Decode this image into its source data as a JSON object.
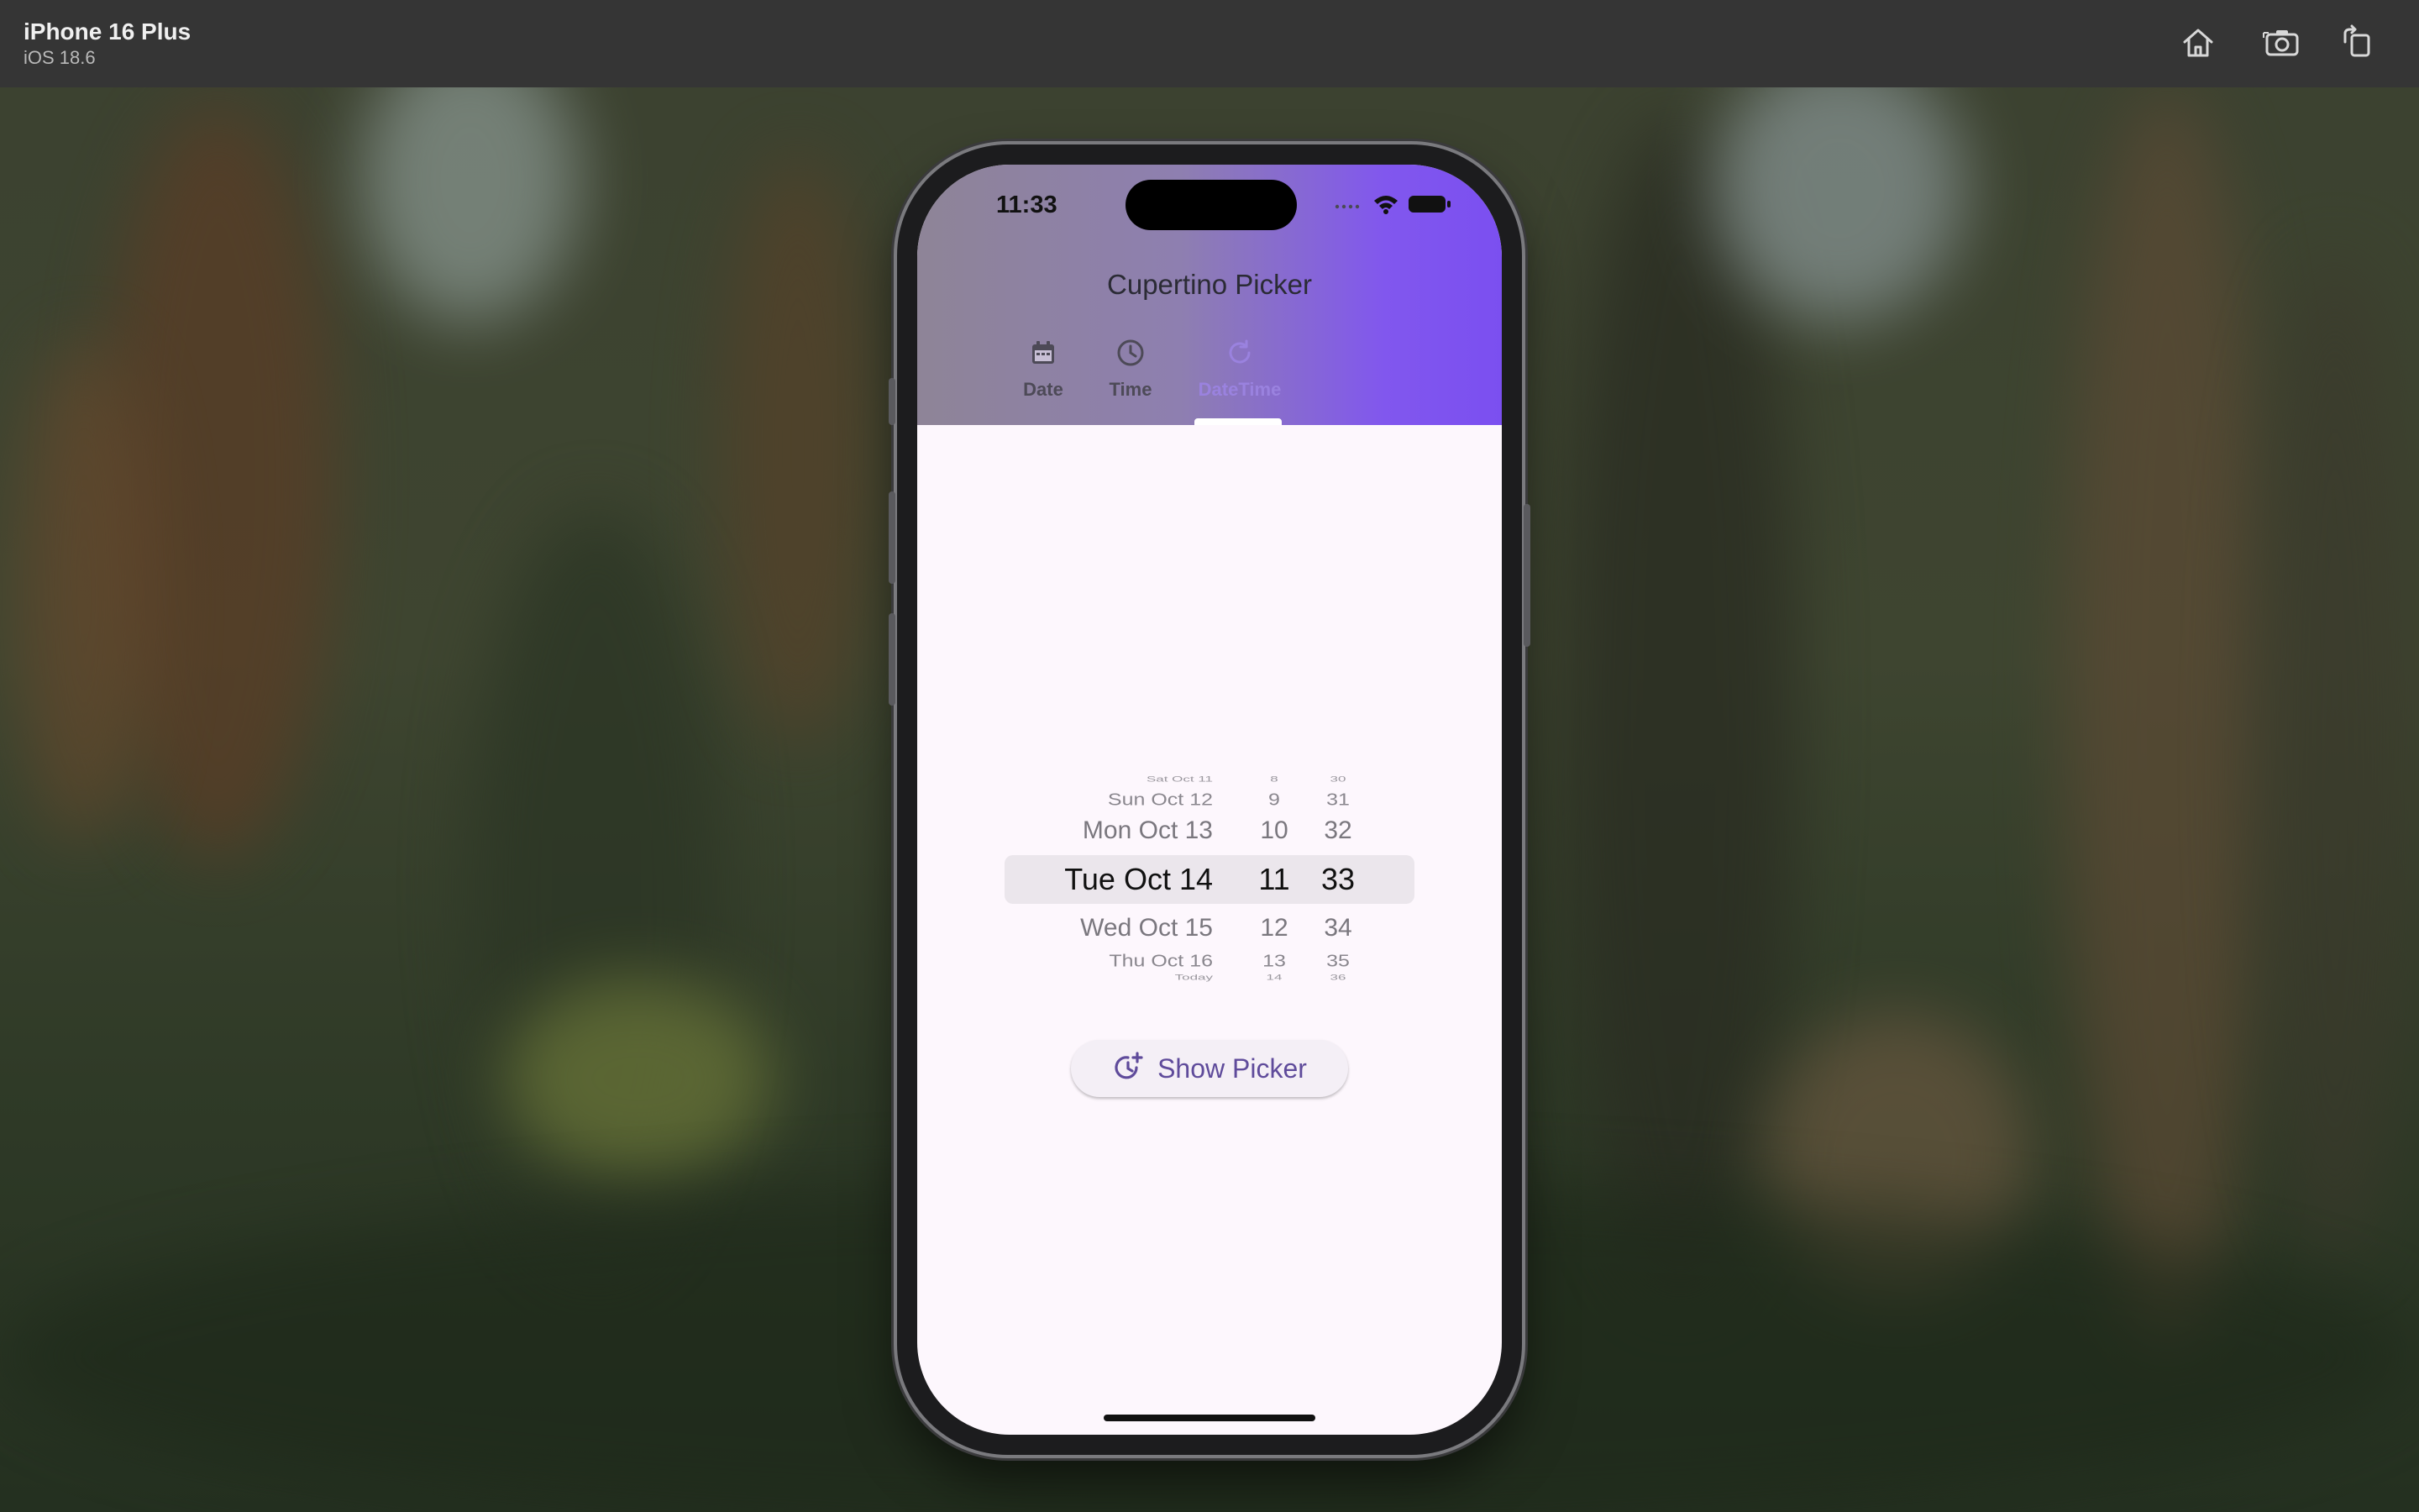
{
  "simulator": {
    "device_name": "iPhone 16 Plus",
    "os_version": "iOS 18.6",
    "toolbar": [
      "home-icon",
      "screenshot-icon",
      "rotate-icon"
    ]
  },
  "status_bar": {
    "time": "11:33"
  },
  "app": {
    "title": "Cupertino Picker",
    "accent_color": "#7b4ff0",
    "tabs": [
      {
        "label": "Date",
        "icon": "calendar-icon",
        "selected": false
      },
      {
        "label": "Time",
        "icon": "clock-icon",
        "selected": false
      },
      {
        "label": "DateTime",
        "icon": "refresh-icon",
        "selected": true
      }
    ]
  },
  "picker": {
    "rows": [
      {
        "date": "Sat Oct 11",
        "hour": "8",
        "minute": "30"
      },
      {
        "date": "Sun Oct 12",
        "hour": "9",
        "minute": "31"
      },
      {
        "date": "Mon Oct 13",
        "hour": "10",
        "minute": "32"
      },
      {
        "date": "Tue Oct 14",
        "hour": "11",
        "minute": "33"
      },
      {
        "date": "Wed Oct 15",
        "hour": "12",
        "minute": "34"
      },
      {
        "date": "Thu Oct 16",
        "hour": "13",
        "minute": "35"
      },
      {
        "date": "Today",
        "hour": "14",
        "minute": "36"
      }
    ],
    "selected_index": 3
  },
  "button": {
    "label": "Show Picker",
    "icon": "clock-plus-icon"
  }
}
